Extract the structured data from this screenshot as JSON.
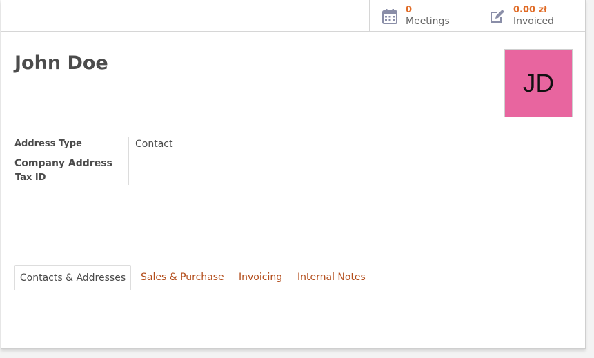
{
  "stat_buttons": {
    "meetings": {
      "value": "0",
      "label": "Meetings",
      "icon": "calendar-icon"
    },
    "invoiced": {
      "value": "0.00 zł",
      "label": "Invoiced",
      "icon": "edit-icon"
    }
  },
  "partner": {
    "name": "John Doe",
    "avatar_initials": "JD",
    "avatar_color": "#e8659f"
  },
  "fields": {
    "address_type_label": "Address Type",
    "address_type_value": "Contact",
    "company_address_label": "Company Address",
    "tax_id_label": "Tax ID"
  },
  "tabs": [
    {
      "label": "Contacts & Addresses",
      "active": true
    },
    {
      "label": "Sales & Purchase",
      "active": false
    },
    {
      "label": "Invoicing",
      "active": false
    },
    {
      "label": "Internal Notes",
      "active": false
    }
  ],
  "colors": {
    "accent": "#e06b26",
    "tab_link": "#b34d1b",
    "text": "#4c4c4c"
  }
}
